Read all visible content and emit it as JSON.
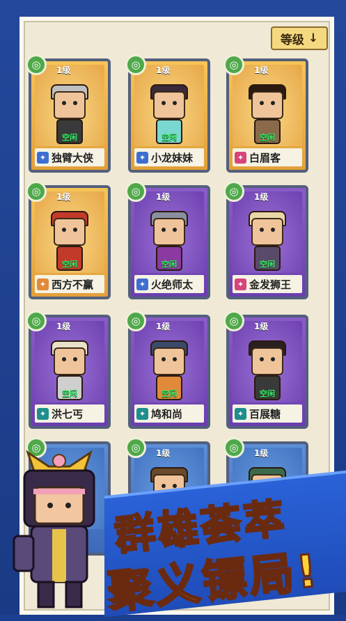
{
  "sort_button": {
    "label": "等级",
    "arrow": "↓"
  },
  "heroes": [
    {
      "level": "1级",
      "status": "空闲",
      "name": "独臂大侠",
      "rarity": "gold",
      "weapon_icon": "sword-icon",
      "weapon_color": "blue"
    },
    {
      "level": "1级",
      "status": "空闲",
      "name": "小龙妹妹",
      "rarity": "gold",
      "weapon_icon": "sword-icon",
      "weapon_color": "blue"
    },
    {
      "level": "1级",
      "status": "空闲",
      "name": "白眉客",
      "rarity": "gold",
      "weapon_icon": "dagger-icon",
      "weapon_color": "pink"
    },
    {
      "level": "1级",
      "status": "空闲",
      "name": "西方不赢",
      "rarity": "gold",
      "weapon_icon": "fan-icon",
      "weapon_color": "orange"
    },
    {
      "level": "1级",
      "status": "空闲",
      "name": "火绝师太",
      "rarity": "purple",
      "weapon_icon": "sword-icon",
      "weapon_color": "blue"
    },
    {
      "level": "1级",
      "status": "空闲",
      "name": "金发狮王",
      "rarity": "purple",
      "weapon_icon": "dagger-icon",
      "weapon_color": "pink"
    },
    {
      "level": "1级",
      "status": "空闲",
      "name": "洪七丐",
      "rarity": "purple",
      "weapon_icon": "palm-icon",
      "weapon_color": "teal"
    },
    {
      "level": "1级",
      "status": "空闲",
      "name": "鸠和尚",
      "rarity": "purple",
      "weapon_icon": "palm-icon",
      "weapon_color": "teal"
    },
    {
      "level": "1级",
      "status": "空闲",
      "name": "百展糖",
      "rarity": "purple",
      "weapon_icon": "palm-icon",
      "weapon_color": "teal"
    },
    {
      "level": "",
      "status": "",
      "name": "",
      "rarity": "blue",
      "weapon_icon": "",
      "weapon_color": ""
    },
    {
      "level": "1级",
      "status": "",
      "name": "",
      "rarity": "blue",
      "weapon_icon": "",
      "weapon_color": ""
    },
    {
      "level": "1级",
      "status": "",
      "name": "",
      "rarity": "blue",
      "weapon_icon": "",
      "weapon_color": ""
    }
  ],
  "banner": {
    "line1": "群雄荟萃",
    "line2": "聚义镖局!"
  },
  "colors": {
    "background": "#1d3f8f",
    "panel": "#efe9d6",
    "gold_card": "#f6c558",
    "purple_card": "#8a5cc7",
    "status_green": "#3ce36a",
    "title_yellow": "#ffd23a"
  }
}
